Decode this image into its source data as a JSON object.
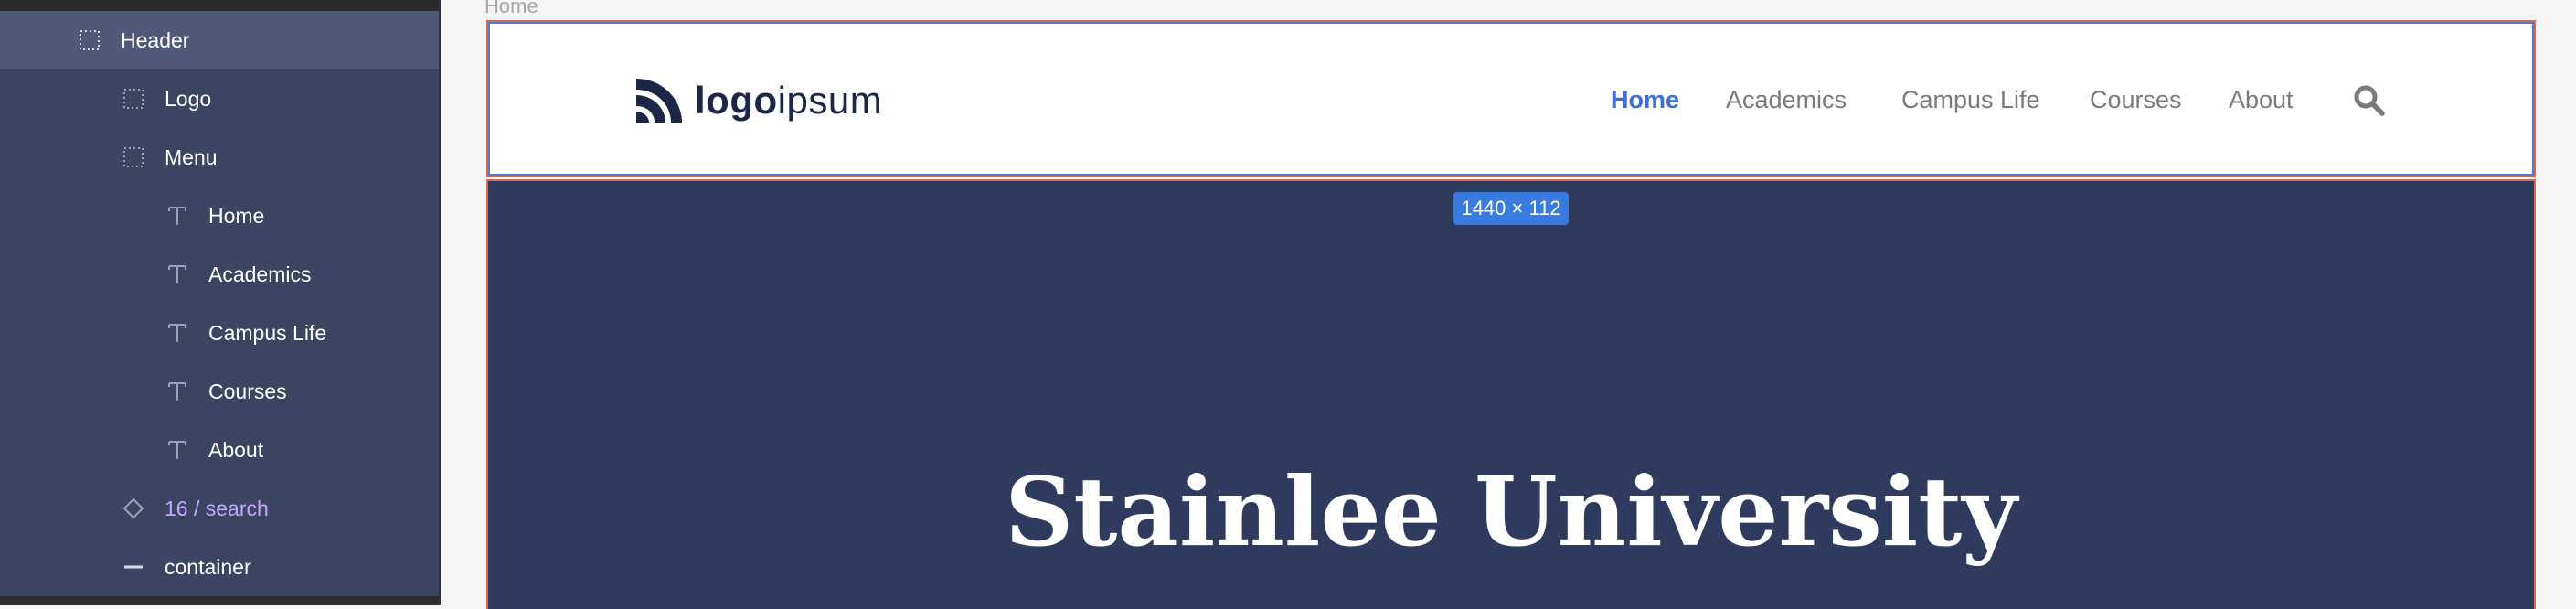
{
  "layers": {
    "items": [
      {
        "label": "Header",
        "icon": "frame-icon"
      },
      {
        "label": "Logo",
        "icon": "frame-icon"
      },
      {
        "label": "Menu",
        "icon": "frame-icon"
      },
      {
        "label": "Home",
        "icon": "text-icon"
      },
      {
        "label": "Academics",
        "icon": "text-icon"
      },
      {
        "label": "Campus Life",
        "icon": "text-icon"
      },
      {
        "label": "Courses",
        "icon": "text-icon"
      },
      {
        "label": "About",
        "icon": "text-icon"
      },
      {
        "label": "16 / search",
        "icon": "component-icon"
      },
      {
        "label": "container",
        "icon": "line-icon"
      }
    ],
    "selected": "Header"
  },
  "canvas": {
    "frame_label": "Home",
    "size_badge": "1440 × 112"
  },
  "site": {
    "logo_bold": "logo",
    "logo_regular": "ipsum",
    "nav": [
      "Home",
      "Academics",
      "Campus Life",
      "Courses",
      "About"
    ],
    "active_nav": "Home",
    "hero_title": "Stainlee University"
  },
  "colors": {
    "layers_bg": "#3b4461",
    "selected_row": "#4f5876",
    "component_text": "#c9a6ff",
    "nav_active": "#3b6fe0",
    "hero_bg": "#2e3b5e",
    "selection_badge": "#3a7be0",
    "frame_border": "#d86a4f"
  }
}
